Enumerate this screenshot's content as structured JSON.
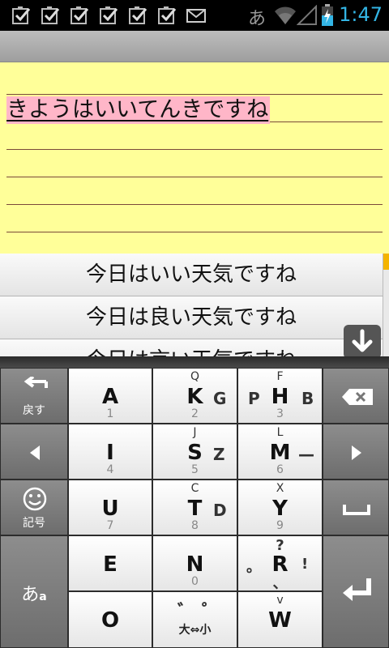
{
  "status_bar": {
    "notification_icons": [
      "checkbox-icon",
      "checkbox-icon",
      "checkbox-icon",
      "checkbox-icon",
      "checkbox-icon",
      "checkbox-icon",
      "mail-icon"
    ],
    "ime_indicator": "あ",
    "time": "1:47",
    "clock_color": "#33b5e5"
  },
  "note": {
    "text": "きようはいいてんきですね",
    "background": "#ffff99",
    "highlight": "#ffb6c8"
  },
  "candidates": [
    "今日はいい天気ですね",
    "今日は良い天気ですね",
    "今日は言い天気ですね"
  ],
  "keyboard": {
    "back_label": "戻す",
    "symbol_label": "記号",
    "mode_label": "あ",
    "mode_sub": "a",
    "size_toggle_label": "大⇔小",
    "keys": {
      "a": {
        "main": "A",
        "bottom": "1"
      },
      "k": {
        "main": "K",
        "top": "Q",
        "right": "G",
        "bottom": "2"
      },
      "h": {
        "main": "H",
        "top": "F",
        "left": "P",
        "right": "B",
        "bottom": "3"
      },
      "i": {
        "main": "I",
        "bottom": "4"
      },
      "s": {
        "main": "S",
        "top": "J",
        "right": "Z",
        "bottom": "5"
      },
      "m": {
        "main": "M",
        "top": "L",
        "right": "—",
        "bottom": "6"
      },
      "u": {
        "main": "U",
        "bottom": "7"
      },
      "t": {
        "main": "T",
        "top": "C",
        "right": "D",
        "bottom": "8"
      },
      "y": {
        "main": "Y",
        "top": "X",
        "bottom": "9"
      },
      "e": {
        "main": "E"
      },
      "n": {
        "main": "N",
        "bottom": "0"
      },
      "r": {
        "main": "R",
        "top": "?",
        "left": "。",
        "right": "!",
        "bottom": "、"
      },
      "o": {
        "main": "O"
      },
      "dakuten": {
        "left": "゛",
        "right": "゜"
      },
      "w": {
        "main": "W",
        "top": "v"
      }
    }
  }
}
